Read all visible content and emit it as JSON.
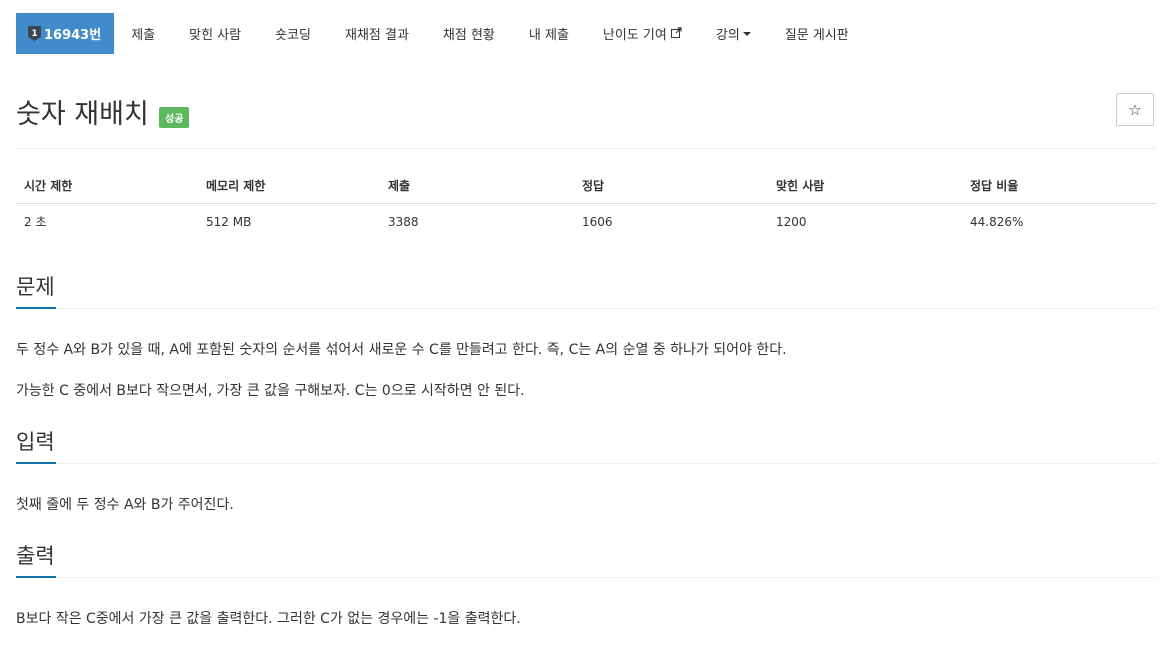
{
  "nav": {
    "problem_tier_number": "1",
    "problem_number": "16943번",
    "items": [
      "제출",
      "맞힌 사람",
      "숏코딩",
      "재채점 결과",
      "채점 현황",
      "내 제출"
    ],
    "difficulty": "난이도 기여",
    "lecture": "강의",
    "board": "질문 게시판"
  },
  "problem": {
    "title": "숫자 재배치",
    "result_badge": "성공",
    "star_icon": "☆"
  },
  "info_table": {
    "headers": [
      "시간 제한",
      "메모리 제한",
      "제출",
      "정답",
      "맞힌 사람",
      "정답 비율"
    ],
    "values": [
      "2 초",
      "512 MB",
      "3388",
      "1606",
      "1200",
      "44.826%"
    ]
  },
  "sections": {
    "description": {
      "title": "문제",
      "paragraphs": [
        "두 정수 A와 B가 있을 때, A에 포함된 숫자의 순서를 섞어서 새로운 수 C를 만들려고 한다. 즉, C는 A의 순열 중 하나가 되어야 한다.",
        "가능한 C 중에서 B보다 작으면서, 가장 큰 값을 구해보자. C는 0으로 시작하면 안 된다."
      ]
    },
    "input": {
      "title": "입력",
      "paragraphs": [
        "첫째 줄에 두 정수 A와 B가 주어진다."
      ]
    },
    "output": {
      "title": "출력",
      "paragraphs": [
        "B보다 작은 C중에서 가장 큰 값을 출력한다. 그러한 C가 없는 경우에는 -1을 출력한다."
      ]
    }
  },
  "colors": {
    "nav_active": "#428bca",
    "success_badge": "#5cb85c",
    "headline_accent": "#0e76a8"
  }
}
